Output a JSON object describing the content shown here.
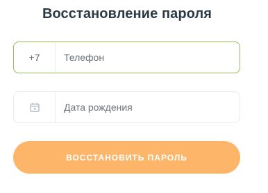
{
  "title": "Восстановление пароля",
  "phone": {
    "prefix": "+7",
    "placeholder": "Телефон",
    "value": ""
  },
  "birth_date": {
    "icon": "calendar-icon",
    "placeholder": "Дата рождения",
    "value": ""
  },
  "submit_label": "ВОССТАНОВИТЬ ПАРОЛЬ",
  "colors": {
    "title": "#2b3a47",
    "active_border": "#8cc152",
    "idle_border": "#e6ebf0",
    "button": "#fdb56a",
    "button_text": "#ffffff"
  }
}
